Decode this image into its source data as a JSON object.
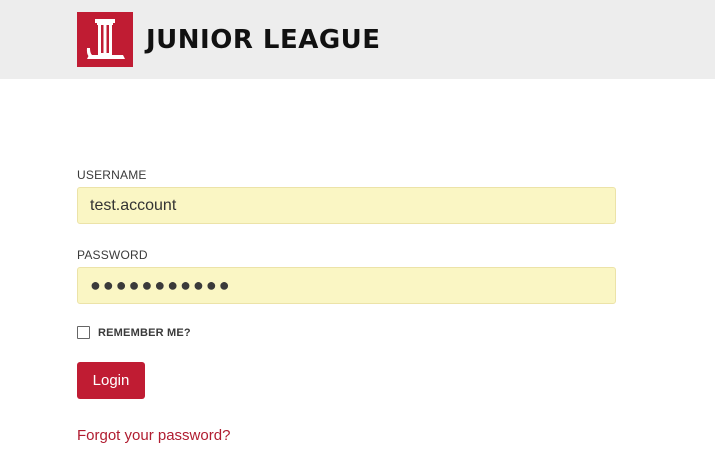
{
  "header": {
    "logo_icon": "junior-league-column-logo",
    "brand_text": "JUNIOR LEAGUE",
    "brand_color": "#c01c33"
  },
  "form": {
    "username_label": "USERNAME",
    "username_value": "test.account",
    "password_label": "PASSWORD",
    "password_display": "●●●●●●●●●●●",
    "remember_label": "REMEMBER ME?",
    "remember_checked": false,
    "login_label": "Login",
    "forgot_link": "Forgot your password?"
  },
  "colors": {
    "header_bg": "#ededed",
    "input_bg": "#faf6c4",
    "accent": "#c01c33"
  }
}
